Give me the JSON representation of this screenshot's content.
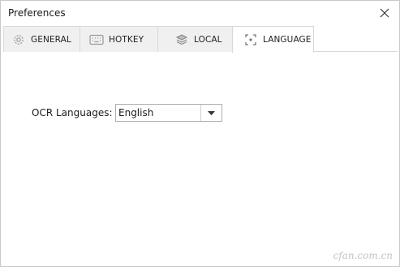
{
  "window": {
    "title": "Preferences"
  },
  "icons": {
    "close": "close-icon",
    "general": "gear-icon",
    "hotkey": "keyboard-icon",
    "local": "layers-icon",
    "language": "scan-frame-icon",
    "dropdown": "chevron-down-icon"
  },
  "tabs": [
    {
      "label": "GENERAL",
      "active": false
    },
    {
      "label": "HOTKEY",
      "active": false
    },
    {
      "label": "LOCAL",
      "active": false
    },
    {
      "label": "LANGUAGE",
      "active": true
    }
  ],
  "language": {
    "ocr_label": "OCR Languages:",
    "selected": "English"
  },
  "watermark": "cfan.com.cn",
  "colors": {
    "tab_bg": "#f0f0f0",
    "border": "#d8d8d8",
    "text": "#1a1a1a"
  }
}
